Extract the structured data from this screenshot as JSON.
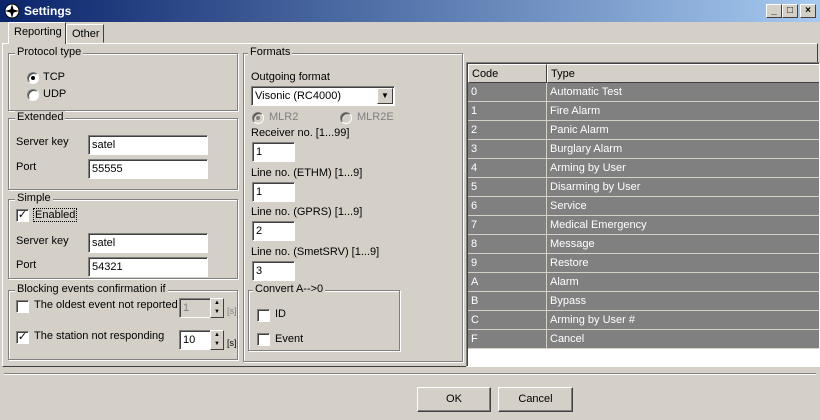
{
  "window": {
    "title": "Settings",
    "controls": {
      "minimize": "_",
      "maximize": "□",
      "close": "×"
    }
  },
  "tabs": [
    "Reporting",
    "Other"
  ],
  "protocol": {
    "title": "Protocol type",
    "options": [
      "TCP",
      "UDP"
    ],
    "selected": "TCP"
  },
  "extended": {
    "title": "Extended",
    "server_key_label": "Server key",
    "server_key": "satel",
    "port_label": "Port",
    "port": "55555"
  },
  "simple": {
    "title": "Simple",
    "enabled_label": "Enabled",
    "enabled": true,
    "server_key_label": "Server key",
    "server_key": "satel",
    "port_label": "Port",
    "port": "54321"
  },
  "blocking": {
    "title": "Blocking events confirmation if",
    "oldest_label": "The oldest event not reported",
    "oldest_checked": false,
    "oldest_value": "1",
    "oldest_unit": "[s]",
    "station_label": "The station not responding",
    "station_checked": true,
    "station_value": "10",
    "station_unit": "[s]"
  },
  "formats": {
    "title": "Formats",
    "outgoing_label": "Outgoing format",
    "outgoing_value": "Visonic (RC4000)",
    "mlr2": "MLR2",
    "mlr2e": "MLR2E",
    "receiver_label": "Receiver no. [1...99]",
    "receiver": "1",
    "line_ethm_label": "Line no. (ETHM) [1...9]",
    "line_ethm": "1",
    "line_gprs_label": "Line no. (GPRS) [1...9]",
    "line_gprs": "2",
    "line_smet_label": "Line no. (SmetSRV) [1...9]",
    "line_smet": "3",
    "convert_title": "Convert A-->0",
    "convert_id": "ID",
    "convert_event": "Event"
  },
  "grid": {
    "columns": [
      "Code",
      "Type"
    ],
    "rows": [
      {
        "code": "0",
        "type": "Automatic Test"
      },
      {
        "code": "1",
        "type": "Fire Alarm"
      },
      {
        "code": "2",
        "type": "Panic Alarm"
      },
      {
        "code": "3",
        "type": "Burglary Alarm"
      },
      {
        "code": "4",
        "type": "Arming by User"
      },
      {
        "code": "5",
        "type": "Disarming by User"
      },
      {
        "code": "6",
        "type": "Service"
      },
      {
        "code": "7",
        "type": "Medical Emergency"
      },
      {
        "code": "8",
        "type": "Message"
      },
      {
        "code": "9",
        "type": "Restore"
      },
      {
        "code": "A",
        "type": "Alarm"
      },
      {
        "code": "B",
        "type": "Bypass"
      },
      {
        "code": "C",
        "type": "Arming by User #"
      },
      {
        "code": "F",
        "type": "Cancel"
      }
    ]
  },
  "buttons": {
    "ok": "OK",
    "cancel": "Cancel"
  },
  "colors": {
    "titlebar": "#0a246a",
    "face": "#d4d0c8",
    "selection": "#808080"
  }
}
